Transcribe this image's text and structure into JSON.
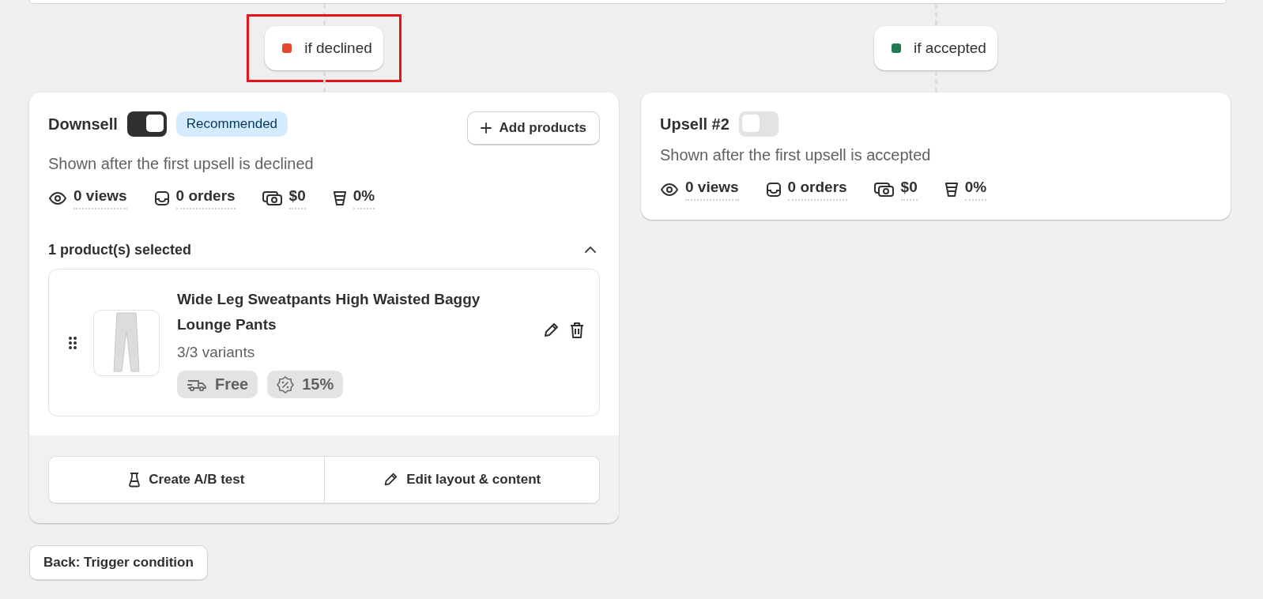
{
  "branches": [
    {
      "label": "if declined",
      "color": "#e5492d",
      "highlighted": true,
      "card": {
        "title": "Downsell",
        "on": true,
        "badge": "Recommended",
        "add_button": "Add products",
        "description": "Shown after the first upsell is declined",
        "stats": [
          {
            "kind": "views",
            "text": "0 views"
          },
          {
            "kind": "orders",
            "text": "0 orders"
          },
          {
            "kind": "revenue",
            "text": "$0"
          },
          {
            "kind": "conversion",
            "text": "0%"
          }
        ],
        "products": {
          "title": "1 product(s) selected",
          "expanded": true,
          "items": [
            {
              "name": "Wide Leg Sweatpants High Waisted Baggy Lounge Pants",
              "variants": "3/3 variants",
              "tags": [
                {
                  "kind": "shipping",
                  "text": "Free"
                },
                {
                  "kind": "discount",
                  "text": "15%"
                }
              ]
            }
          ]
        },
        "actions": [
          {
            "kind": "ab",
            "label": "Create A/B test"
          },
          {
            "kind": "edit",
            "label": "Edit layout & content"
          }
        ]
      }
    },
    {
      "label": "if accepted",
      "color": "#217a52",
      "highlighted": false,
      "card": {
        "title": "Upsell #2",
        "on": false,
        "description": "Shown after the first upsell is accepted",
        "stats": [
          {
            "kind": "views",
            "text": "0 views"
          },
          {
            "kind": "orders",
            "text": "0 orders"
          },
          {
            "kind": "revenue",
            "text": "$0"
          },
          {
            "kind": "conversion",
            "text": "0%"
          }
        ]
      }
    }
  ],
  "back_button": "Back: Trigger condition"
}
